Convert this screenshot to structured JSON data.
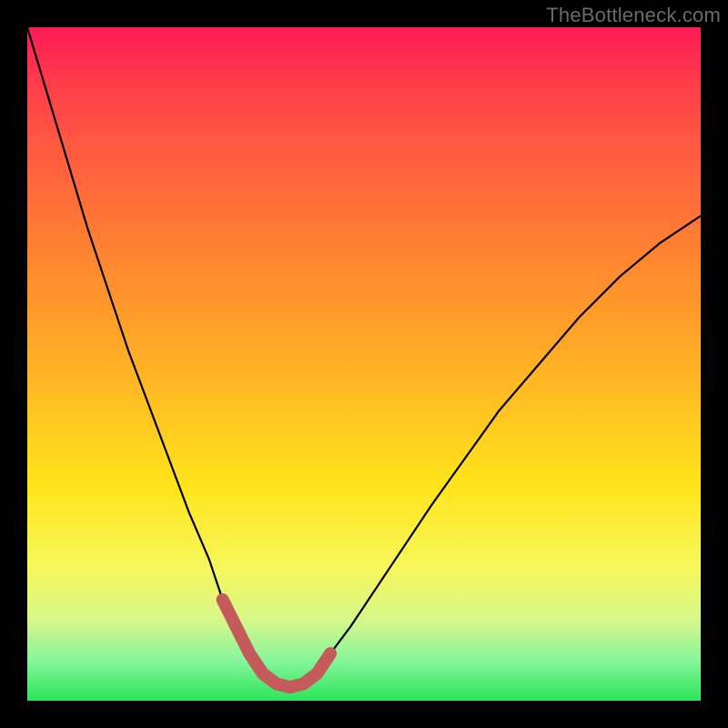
{
  "watermark": "TheBottleneck.com",
  "colors": {
    "frame_bg": "#000000",
    "curve": "#000000",
    "marker": "#c45a5a",
    "gradient_top": "#ff1a55",
    "gradient_bottom": "#2ae65a"
  },
  "chart_data": {
    "type": "line",
    "title": "",
    "xlabel": "",
    "ylabel": "",
    "xlim": [
      0,
      100
    ],
    "ylim": [
      0,
      100
    ],
    "grid": false,
    "legend": false,
    "series": [
      {
        "name": "curve",
        "x": [
          0,
          3,
          6,
          9,
          12,
          15,
          18,
          21,
          24,
          27,
          29,
          31,
          33,
          35,
          37,
          39,
          41,
          43,
          45,
          48,
          52,
          56,
          60,
          65,
          70,
          76,
          82,
          88,
          94,
          100
        ],
        "y": [
          100,
          90,
          80,
          70,
          61,
          52,
          44,
          36,
          28,
          21,
          15,
          11,
          7,
          4,
          2.5,
          2,
          2.5,
          4,
          7,
          11,
          17,
          23,
          29,
          36,
          43,
          50,
          57,
          63,
          68,
          72
        ]
      }
    ],
    "markers": {
      "name": "optimal-band",
      "x": [
        29,
        31,
        33,
        35,
        37,
        39,
        41,
        43,
        45
      ],
      "y": [
        15,
        11,
        7,
        4,
        2.5,
        2,
        2.5,
        4,
        7
      ]
    }
  }
}
